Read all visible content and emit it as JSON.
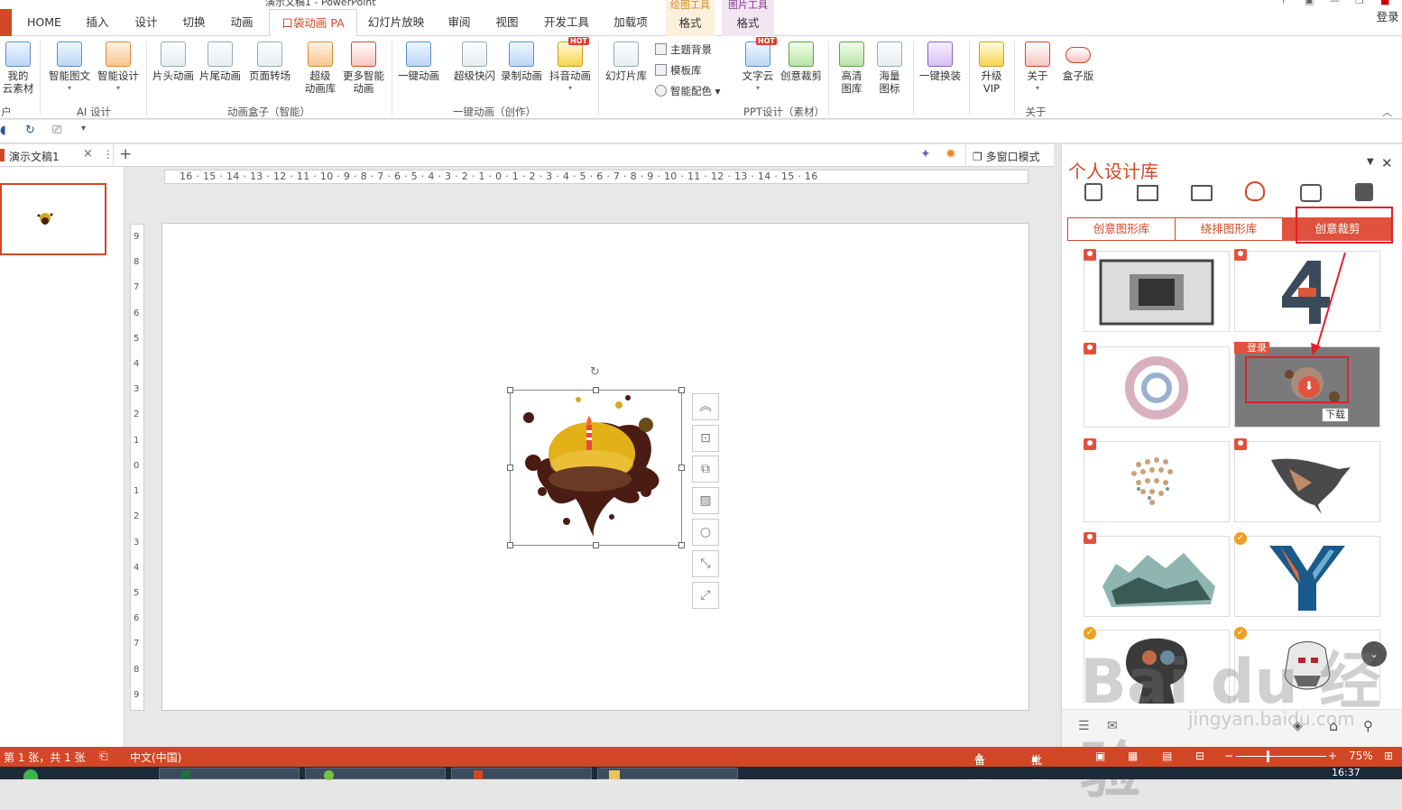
{
  "window": {
    "title": "演示文稿1 - PowerPoint",
    "login": "登录",
    "help": "?"
  },
  "tabs": {
    "file": "",
    "items": [
      "HOME",
      "插入",
      "设计",
      "切换",
      "动画",
      "口袋动画 PA",
      "幻灯片放映",
      "审阅",
      "视图",
      "开发工具",
      "加载项"
    ],
    "active": "口袋动画 PA",
    "context1": {
      "group": "绘图工具",
      "tab": "格式"
    },
    "context2": {
      "group": "图片工具",
      "tab": "格式"
    }
  },
  "ribbon": {
    "buttons": {
      "my_cloud": "我的\n云素材",
      "smart_graphic": "智能图文",
      "smart_design": "智能设计",
      "title_anim": "片头动画",
      "tail_anim": "片尾动画",
      "page_transition": "页面转场",
      "super_anim_lib": "超级\n动画库",
      "more_smart_anim": "更多智能\n动画",
      "one_key_anim": "一键动画",
      "super_flash": "超级快闪",
      "record_anim": "录制动画",
      "douyin_anim": "抖音动画",
      "slide_lib": "幻灯片库",
      "theme_bg": "主题背景",
      "template_lib": "模板库",
      "smart_color": "智能配色",
      "word_cloud": "文字云",
      "creative_crop": "创意裁剪",
      "hd_gallery": "高清\n图库",
      "icons": "海量\n图标",
      "one_key_skin": "一键换装",
      "upgrade_vip": "升级\nVIP",
      "about": "关于",
      "box_version": "盒子版"
    },
    "hot_label": "HOT",
    "groups": {
      "user": "户",
      "ai_design": "AI 设计",
      "anim_box": "动画盒子（智能）",
      "one_key": "一键动画（创作）",
      "ppt_design": "PPT设计（素材）",
      "about": "关于"
    }
  },
  "doc_tab": {
    "name": "演示文稿1",
    "add": "+",
    "multi_window": "多窗口模式"
  },
  "ruler": {
    "horizontal": "16 · 15 · 14 · 13 · 12 · 11 · 10 · 9 · 8 · 7 · 6 · 5 · 4 · 3 · 2 · 1 · 0 · 1 · 2 · 3 · 4 · 5 · 6 · 7 · 8 · 9 · 10 · 11 · 12 · 13 · 14 · 15 · 16",
    "vertical": [
      "9",
      "8",
      "7",
      "6",
      "5",
      "4",
      "3",
      "2",
      "1",
      "0",
      "1",
      "2",
      "3",
      "4",
      "5",
      "6",
      "7",
      "8",
      "9"
    ]
  },
  "side_panel": {
    "title": "个人设计库",
    "subtabs": [
      "创意图形库",
      "绕排图形库",
      "创意裁剪"
    ],
    "active_subtab": "创意裁剪",
    "login_badge": "登录",
    "download_tooltip": "下载",
    "watermark": "Bai du 经验",
    "watermark_url": "jingyan.baidu.com"
  },
  "status": {
    "slide_info": "第 1 张，共 1 张",
    "language": "中文(中国)",
    "notes": "备注",
    "comments": "批注",
    "zoom": "75%",
    "time": "16:37"
  },
  "colors": {
    "accent": "#d24726",
    "highlight_box": "#e0202a",
    "context_drawing": "#d88a1c",
    "context_picture": "#8a3b8f"
  }
}
